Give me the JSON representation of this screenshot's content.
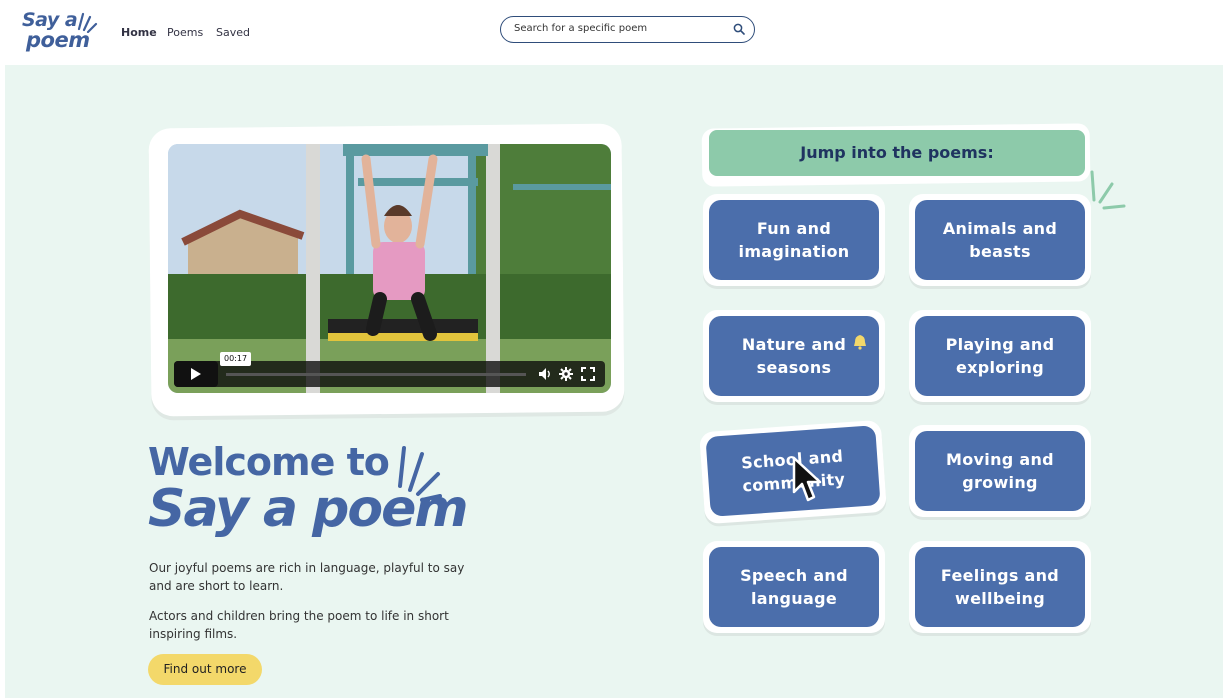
{
  "header": {
    "logo_line1": "Say a",
    "logo_line2": "poem",
    "nav": [
      "Home",
      "Poems",
      "Saved"
    ],
    "search_placeholder": "Search for a specific poem"
  },
  "video": {
    "timestamp": "00:17"
  },
  "welcome": {
    "line1": "Welcome to",
    "line2": "Say a poem",
    "para1": "Our joyful poems are rich in language, playful to say and are short to learn.",
    "para2": "Actors and children bring the poem to life in short inspiring films.",
    "cta_label": "Find out more"
  },
  "poems": {
    "heading": "Jump into the poems:",
    "categories": [
      "Fun and imagination",
      "Animals and beasts",
      "Nature and seasons",
      "Playing and exploring",
      "School and community",
      "Moving and growing",
      "Speech and language",
      "Feelings and wellbeing"
    ]
  },
  "colors": {
    "brand_blue": "#4566a4",
    "tile_blue": "#4b6eab",
    "heading_green": "#8dcaaa",
    "cta_yellow": "#f3d86a",
    "background": "#eaf6f1"
  }
}
